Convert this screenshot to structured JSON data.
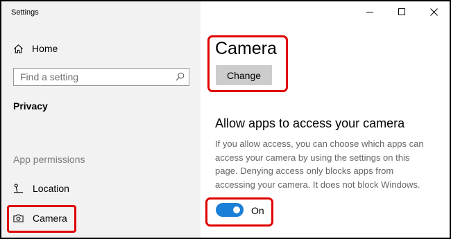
{
  "app_title": "Settings",
  "sidebar": {
    "home_label": "Home",
    "search_placeholder": "Find a setting",
    "section_title": "Privacy",
    "group_label": "App permissions",
    "items": [
      {
        "label": "Location",
        "icon": "location-icon"
      },
      {
        "label": "Camera",
        "icon": "camera-icon",
        "selected": true
      }
    ]
  },
  "main": {
    "title": "Camera",
    "change_button": "Change",
    "section_heading": "Allow apps to access your camera",
    "description": "If you allow access, you can choose which apps can access your camera by using the settings on this page. Denying access only blocks apps from accessing your camera. It does not block Windows.",
    "toggle_state": "On",
    "toggle_on": true
  },
  "window_controls": [
    "minimize",
    "maximize",
    "close"
  ],
  "colors": {
    "accent": "#1a7fd6",
    "annotation": "#e00000",
    "sidebar_bg": "#f2f2f2",
    "button_bg": "#cccccc"
  }
}
